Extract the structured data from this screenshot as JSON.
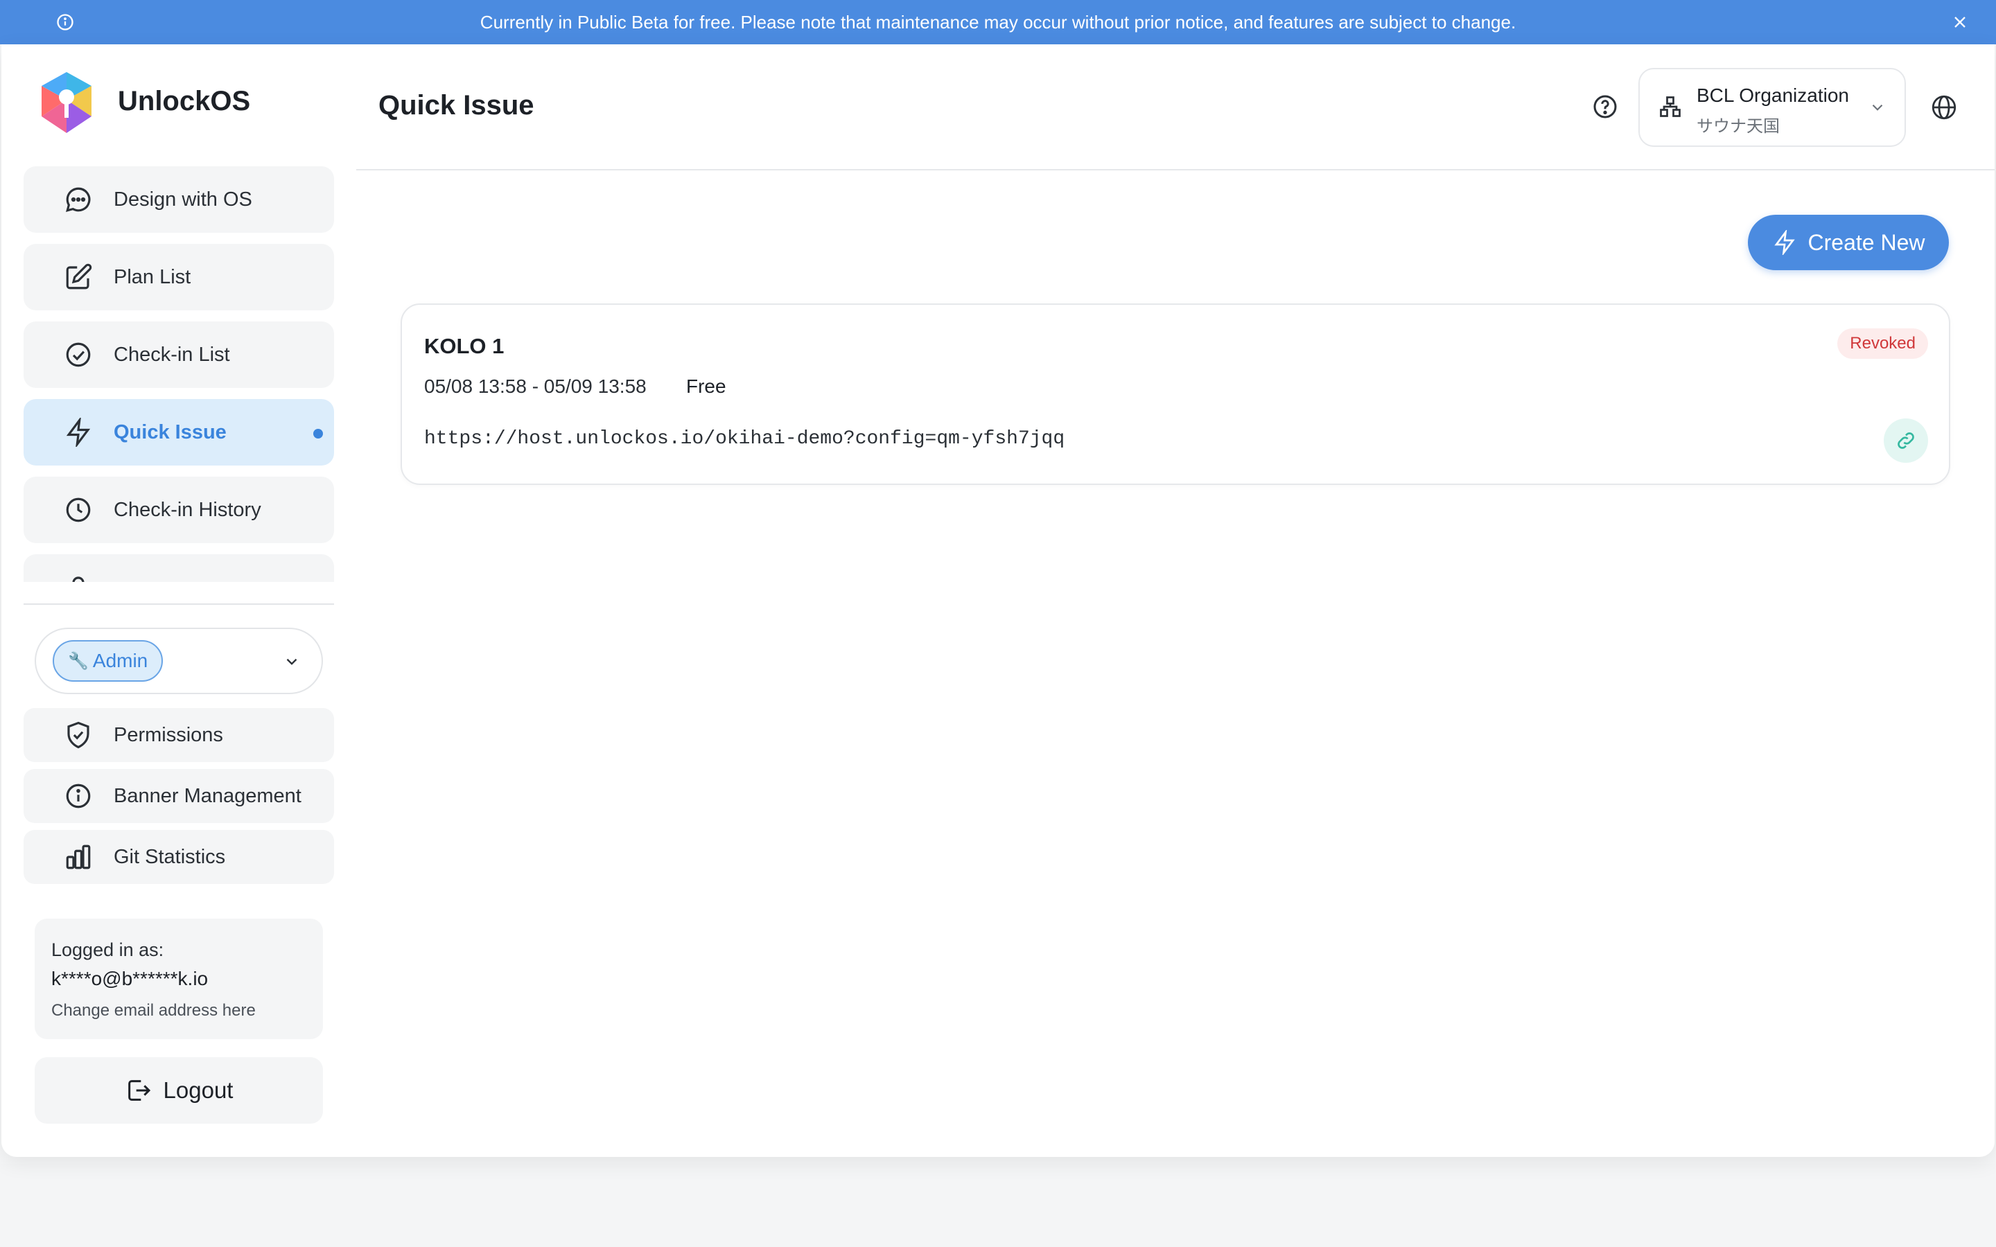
{
  "banner": {
    "text": "Currently in Public Beta for free. Please note that maintenance may occur without prior notice, and features are subject to change."
  },
  "app": {
    "name": "UnlockOS"
  },
  "sidebar": {
    "items": [
      {
        "label": "Design with OS",
        "icon": "chat-bubble-icon"
      },
      {
        "label": "Plan List",
        "icon": "edit-icon"
      },
      {
        "label": "Check-in List",
        "icon": "check-circle-icon"
      },
      {
        "label": "Quick Issue",
        "icon": "lightning-icon",
        "active": true
      },
      {
        "label": "Check-in History",
        "icon": "clock-icon"
      }
    ]
  },
  "role": {
    "label": "Admin",
    "icon": "wrench-icon"
  },
  "admin_items": [
    {
      "label": "Permissions",
      "icon": "shield-check-icon"
    },
    {
      "label": "Banner Management",
      "icon": "info-icon"
    },
    {
      "label": "Git Statistics",
      "icon": "bar-chart-icon"
    }
  ],
  "user": {
    "logged_in_label": "Logged in as:",
    "email": "k****o@b******k.io",
    "change_email_label": "Change email address here"
  },
  "logout_label": "Logout",
  "header": {
    "title": "Quick Issue",
    "org_name": "BCL Organization",
    "org_sub": "サウナ天国"
  },
  "create_button_label": "Create New",
  "issues": [
    {
      "title": "KOLO 1",
      "period": "05/08 13:58 - 05/09 13:58",
      "type": "Free",
      "url": "https://host.unlockos.io/okihai-demo?config=qm-yfsh7jqq",
      "status": "Revoked"
    }
  ],
  "colors": {
    "accent": "#4b8be0",
    "active_bg": "#dcedfb",
    "revoked_text": "#d0383a",
    "revoked_bg": "#fdecec",
    "link_bg": "#e3f6f2"
  }
}
